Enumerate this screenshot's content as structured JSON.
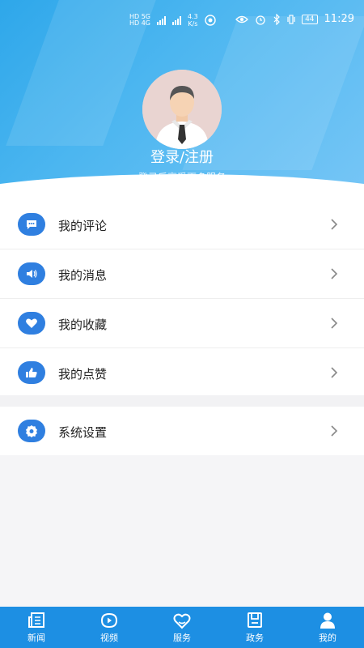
{
  "status": {
    "left_labels": [
      "HD 5G",
      "HD 4G"
    ],
    "speed_value": "4.3",
    "speed_unit": "K/s",
    "battery": "44",
    "time": "11:29"
  },
  "profile": {
    "login_title": "登录/注册",
    "login_subtitle": "登录后享受更多服务"
  },
  "menu": [
    {
      "label": "我的评论",
      "icon": "comment-icon"
    },
    {
      "label": "我的消息",
      "icon": "speaker-icon"
    },
    {
      "label": "我的收藏",
      "icon": "heart-icon"
    },
    {
      "label": "我的点赞",
      "icon": "thumbs-up-icon"
    }
  ],
  "settings": {
    "label": "系统设置",
    "icon": "gear-icon"
  },
  "tabs": [
    {
      "label": "新闻",
      "icon": "news-icon"
    },
    {
      "label": "视频",
      "icon": "video-icon"
    },
    {
      "label": "服务",
      "icon": "service-heart-icon"
    },
    {
      "label": "政务",
      "icon": "government-icon"
    },
    {
      "label": "我的",
      "icon": "profile-icon"
    }
  ],
  "colors": {
    "accent": "#2f7fe0",
    "tabbar": "#1d8fe3",
    "header": "#2ea7ea"
  }
}
